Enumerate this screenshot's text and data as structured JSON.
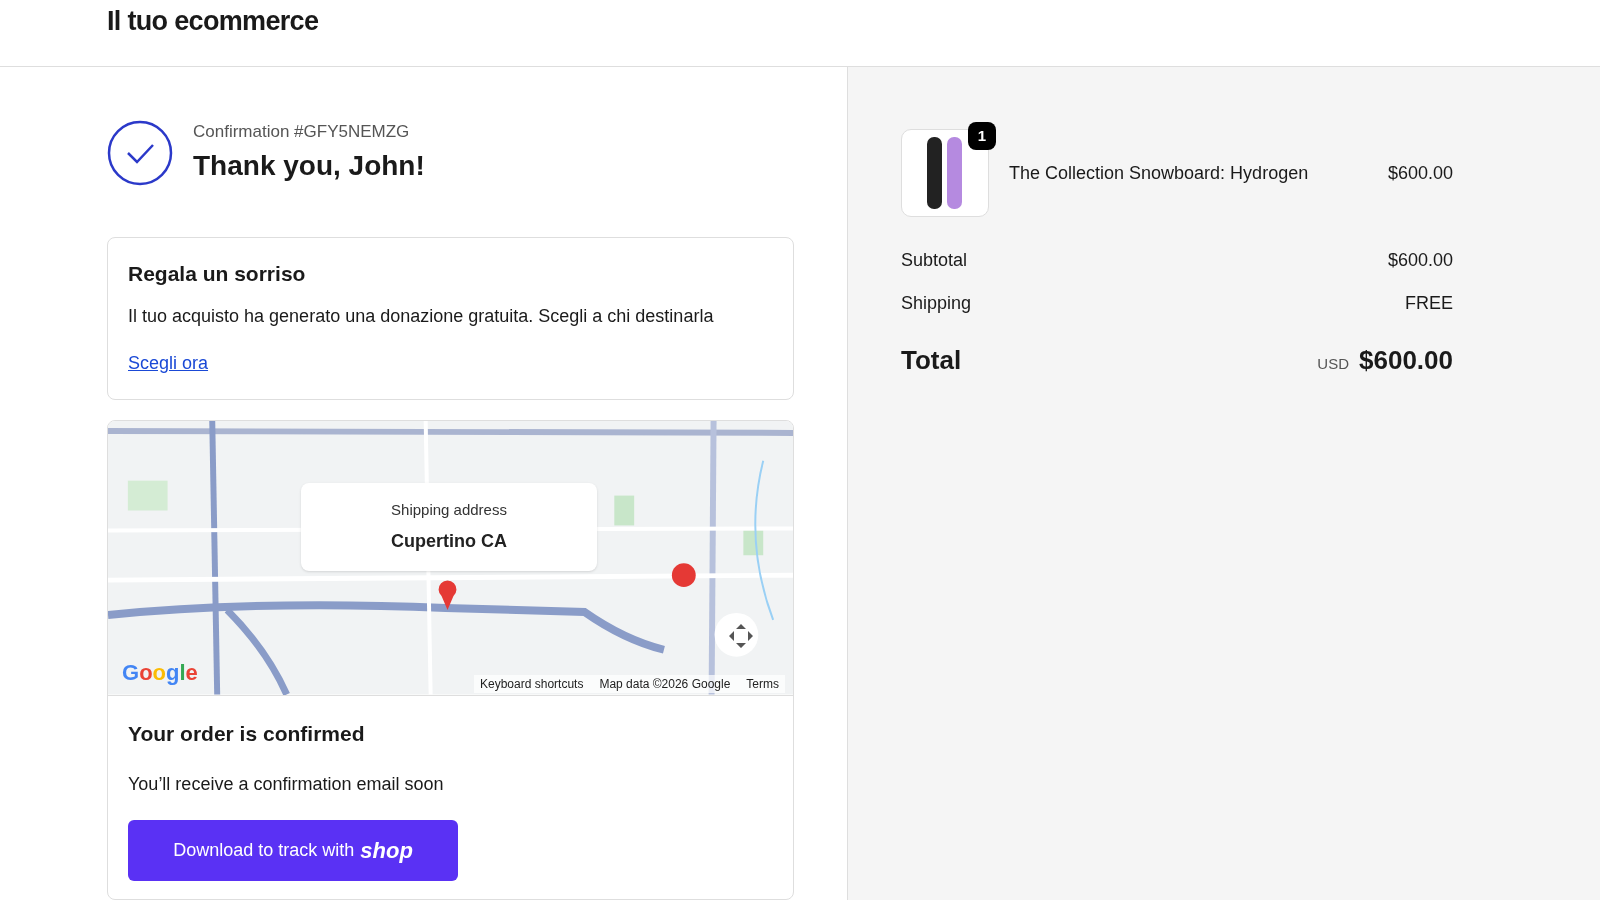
{
  "header": {
    "title": "Il tuo ecommerce"
  },
  "confirmation": {
    "number": "Confirmation #GFY5NEMZG",
    "greeting": "Thank you, John!"
  },
  "donation": {
    "title": "Regala un sorriso",
    "text": "Il tuo acquisto ha generato una donazione gratuita. Scegli a chi destinarla",
    "link": "Scegli ora"
  },
  "map": {
    "kind": "picture",
    "popup_label": "Shipping address",
    "popup_value": "Cupertino CA",
    "logo": "Google",
    "footer": [
      "Keyboard shortcuts",
      "Map data ©2026 Google",
      "Terms"
    ]
  },
  "order_status": {
    "title": "Your order is confirmed",
    "text": "You’ll receive a confirmation email soon",
    "button": "Download to track with",
    "button_logo": "shop"
  },
  "summary": {
    "items": [
      {
        "name": "The Collection Snowboard: Hydrogen",
        "price": "$600.00",
        "quantity": "1"
      }
    ],
    "lines": [
      {
        "label": "Subtotal",
        "value": "$600.00"
      },
      {
        "label": "Shipping",
        "value": "FREE"
      }
    ],
    "total": {
      "label": "Total",
      "currency": "USD",
      "value": "$600.00"
    }
  }
}
